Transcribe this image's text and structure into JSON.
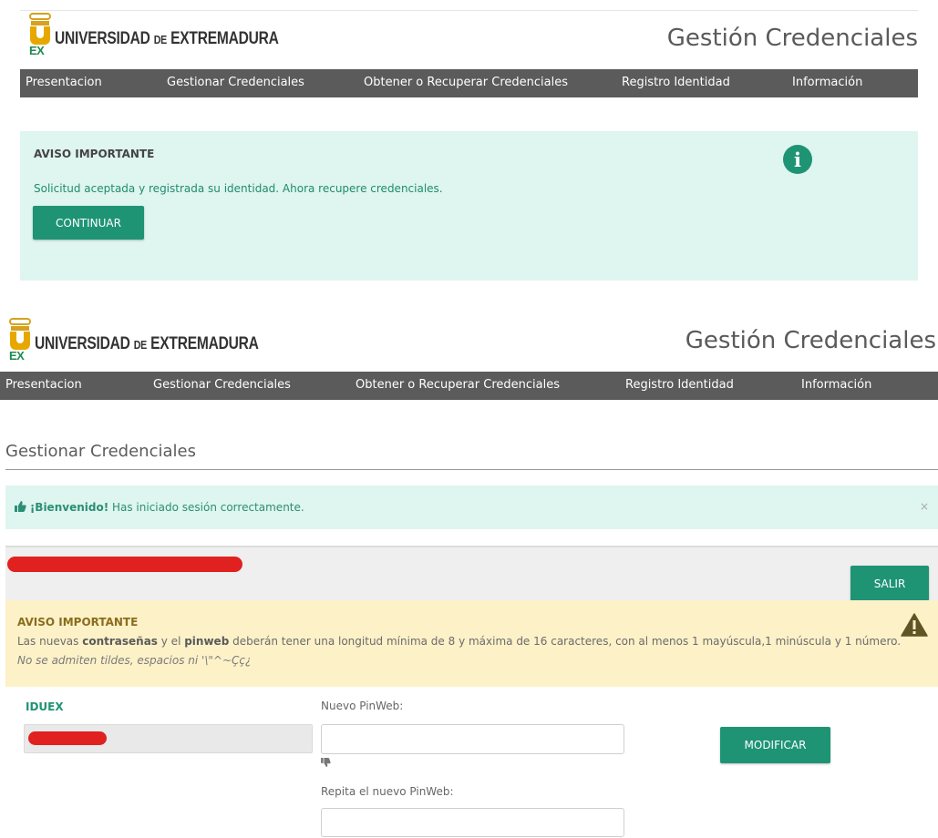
{
  "header": {
    "university_prefix": "UNIVERSIDAD",
    "university_de": "DE",
    "university_name": "EXTREMADURA",
    "crest_letters": "EX",
    "app_title": "Gestión Credenciales"
  },
  "nav": {
    "items": [
      "Presentacion",
      "Gestionar Credenciales",
      "Obtener o Recuperar Credenciales",
      "Registro Identidad",
      "Información"
    ]
  },
  "notice1": {
    "title": "AVISO IMPORTANTE",
    "message": "Solicitud aceptada y registrada su identidad. Ahora recupere credenciales.",
    "button": "CONTINUAR",
    "icon": "info-icon"
  },
  "page": {
    "title": "Gestionar Credenciales"
  },
  "welcome": {
    "strong": "¡Bienvenido!",
    "message": " Has iniciado sesión correctamente.",
    "close": "×",
    "icon": "thumbs-up-icon"
  },
  "userbar": {
    "logout_button": "SALIR"
  },
  "warning": {
    "title": "AVISO IMPORTANTE",
    "line1_a": "Las nuevas ",
    "line1_b": "contraseñas",
    "line1_c": " y el ",
    "line1_d": "pinweb",
    "line1_e": " deberán tener una longitud mínima de 8 y máxima de 16 caracteres, con al menos 1 mayúscula,1 minúscula y 1 número.",
    "line2": "No se admiten tildes, espacios ni '\\\"^~Çç¿",
    "icon": "warning-triangle-icon"
  },
  "form": {
    "iduex_label": "IDUEX",
    "new_pin_label": "Nuevo PinWeb:",
    "new_pin_value": "",
    "repeat_pin_label": "Repita el nuevo PinWeb:",
    "repeat_pin_value": "",
    "submit_button": "MODIFICAR",
    "strength_icon": "thumbs-down-icon"
  },
  "colors": {
    "accent": "#1e9475",
    "navbar": "#5b5b5b",
    "info_bg": "#dff5ef",
    "warning_bg": "#fdf1c8"
  }
}
